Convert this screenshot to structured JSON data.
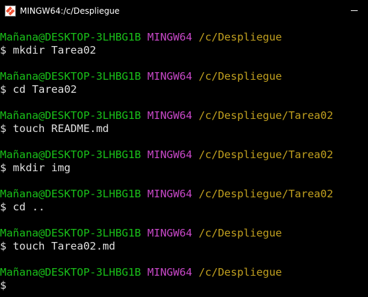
{
  "window": {
    "title": "MINGW64:/c/Despliegue",
    "icon": "git-bash-icon"
  },
  "colors": {
    "background": "#000000",
    "user": "#19c119",
    "shell": "#c848c8",
    "path": "#c1a01f",
    "text": "#e0e0e0"
  },
  "terminal": {
    "entries": [
      {
        "user": "Mañana@DESKTOP-3LHBG1B",
        "shell": "MINGW64",
        "path": "/c/Despliegue",
        "command": "$ mkdir Tarea02"
      },
      {
        "user": "Mañana@DESKTOP-3LHBG1B",
        "shell": "MINGW64",
        "path": "/c/Despliegue",
        "command": "$ cd Tarea02"
      },
      {
        "user": "Mañana@DESKTOP-3LHBG1B",
        "shell": "MINGW64",
        "path": "/c/Despliegue/Tarea02",
        "command": "$ touch README.md"
      },
      {
        "user": "Mañana@DESKTOP-3LHBG1B",
        "shell": "MINGW64",
        "path": "/c/Despliegue/Tarea02",
        "command": "$ mkdir img"
      },
      {
        "user": "Mañana@DESKTOP-3LHBG1B",
        "shell": "MINGW64",
        "path": "/c/Despliegue/Tarea02",
        "command": "$ cd .."
      },
      {
        "user": "Mañana@DESKTOP-3LHBG1B",
        "shell": "MINGW64",
        "path": "/c/Despliegue",
        "command": "$ touch Tarea02.md"
      },
      {
        "user": "Mañana@DESKTOP-3LHBG1B",
        "shell": "MINGW64",
        "path": "/c/Despliegue",
        "command": "$"
      }
    ]
  }
}
